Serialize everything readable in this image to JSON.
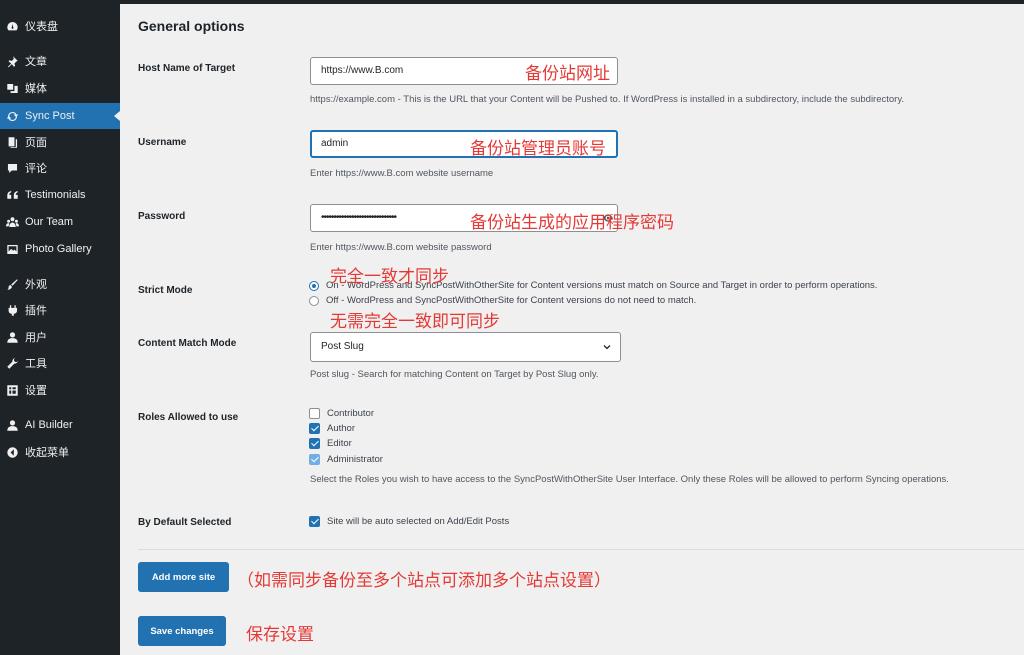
{
  "sidebar": {
    "items": [
      {
        "label": "仪表盘",
        "icon": "dashboard-icon"
      },
      {
        "label": "文章",
        "icon": "pin-icon"
      },
      {
        "label": "媒体",
        "icon": "media-icon"
      },
      {
        "label": "Sync Post",
        "icon": "sync-icon",
        "active": true
      },
      {
        "label": "页面",
        "icon": "page-icon"
      },
      {
        "label": "评论",
        "icon": "comment-icon"
      },
      {
        "label": "Testimonials",
        "icon": "quote-icon"
      },
      {
        "label": "Our Team",
        "icon": "team-icon"
      },
      {
        "label": "Photo Gallery",
        "icon": "gallery-icon"
      },
      {
        "label": "外观",
        "icon": "brush-icon"
      },
      {
        "label": "插件",
        "icon": "plugin-icon"
      },
      {
        "label": "用户",
        "icon": "user-icon"
      },
      {
        "label": "工具",
        "icon": "wrench-icon"
      },
      {
        "label": "设置",
        "icon": "settings-icon"
      },
      {
        "label": "AI Builder",
        "icon": "user-icon"
      },
      {
        "label": "收起菜单",
        "icon": "collapse-icon"
      }
    ]
  },
  "main": {
    "title": "General options",
    "host": {
      "label": "Host Name of Target",
      "value": "https://www.B.com",
      "description": "https://example.com - This is the URL that your Content will be Pushed to. If WordPress is installed in a subdirectory, include the subdirectory."
    },
    "username": {
      "label": "Username",
      "value": "admin",
      "description": "Enter https://www.B.com website username"
    },
    "password": {
      "label": "Password",
      "value": "••••••••••••••••••••••••••••••",
      "description": "Enter https://www.B.com website password"
    },
    "strict_mode": {
      "label": "Strict Mode",
      "options": [
        {
          "text": "On - WordPress and SyncPostWithOtherSite for Content versions must match on Source and Target in order to perform operations.",
          "selected": true
        },
        {
          "text": "Off - WordPress and SyncPostWithOtherSite for Content versions do not need to match.",
          "selected": false
        }
      ]
    },
    "content_match": {
      "label": "Content Match Mode",
      "value": "Post Slug",
      "description": "Post slug - Search for matching Content on Target by Post Slug only."
    },
    "roles": {
      "label": "Roles Allowed to use",
      "options": [
        {
          "text": "Contributor",
          "checked": false
        },
        {
          "text": "Author",
          "checked": true
        },
        {
          "text": "Editor",
          "checked": true
        },
        {
          "text": "Administrator",
          "checked": true,
          "disabled": true
        }
      ],
      "description": "Select the Roles you wish to have access to the SyncPostWithOtherSite User Interface. Only these Roles will be allowed to perform Syncing operations."
    },
    "default_selected": {
      "label": "By Default Selected",
      "text": "Site will be auto selected on Add/Edit Posts",
      "checked": true
    },
    "add_more_label": "Add more site",
    "save_label": "Save changes"
  },
  "annotations": {
    "host": "备份站网址",
    "username": "备份站管理员账号",
    "password": "备份站生成的应用程序密码",
    "strict_on": "完全一致才同步",
    "strict_off": "无需完全一致即可同步",
    "add_more": "（如需同步备份至多个站点可添加多个站点设置）",
    "save": "保存设置"
  },
  "colors": {
    "sidebar_bg": "#1d2327",
    "accent": "#2271b1",
    "annotation": "#e53935"
  }
}
